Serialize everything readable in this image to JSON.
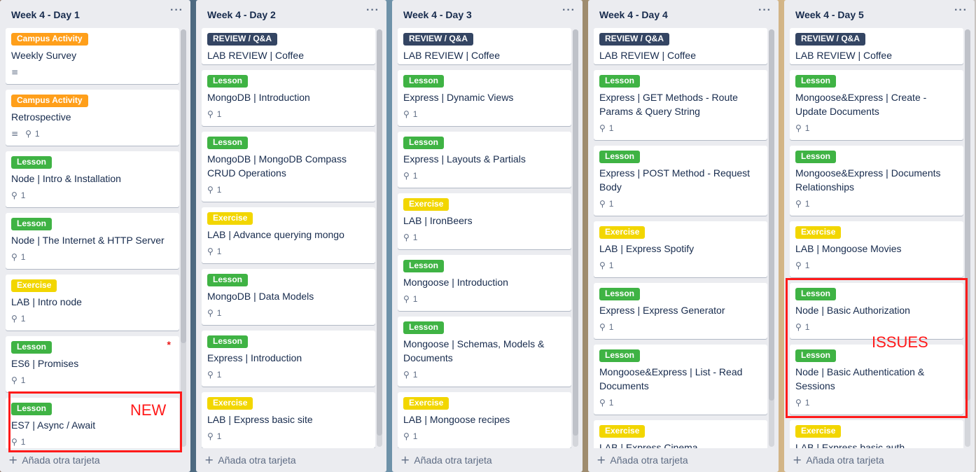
{
  "lists": [
    {
      "title": "Week 4 - Day 1",
      "add_card": "Añada otra tarjeta",
      "cards": [
        {
          "label": "Campus Activity",
          "label_color": "orange",
          "title": "Weekly Survey",
          "description": true,
          "attachments": ""
        },
        {
          "label": "Campus Activity",
          "label_color": "orange",
          "title": "Retrospective",
          "description": true,
          "attachments": "1"
        },
        {
          "label": "Lesson",
          "label_color": "green",
          "title": "Node | Intro & Installation",
          "description": false,
          "attachments": "1"
        },
        {
          "label": "Lesson",
          "label_color": "green",
          "title": "Node | The Internet & HTTP Server",
          "description": false,
          "attachments": "1"
        },
        {
          "label": "Exercise",
          "label_color": "yellow",
          "title": "LAB | Intro node",
          "description": false,
          "attachments": "1"
        },
        {
          "label": "Lesson",
          "label_color": "green",
          "title": "ES6 | Promises",
          "description": false,
          "attachments": "1",
          "star": "*"
        },
        {
          "label": "Lesson",
          "label_color": "green",
          "title": "ES7 | Async / Await",
          "description": false,
          "attachments": "1"
        }
      ]
    },
    {
      "title": "Week 4 - Day 2",
      "add_card": "Añada otra tarjeta",
      "cards": [
        {
          "label": "REVIEW / Q&A",
          "label_color": "dark",
          "title": "LAB REVIEW | Coffee",
          "description": false,
          "attachments": ""
        },
        {
          "label": "Lesson",
          "label_color": "green",
          "title": "MongoDB | Introduction",
          "description": false,
          "attachments": "1"
        },
        {
          "label": "Lesson",
          "label_color": "green",
          "title": "MongoDB | MongoDB Compass CRUD Operations",
          "description": false,
          "attachments": "1"
        },
        {
          "label": "Exercise",
          "label_color": "yellow",
          "title": "LAB | Advance querying mongo",
          "description": false,
          "attachments": "1"
        },
        {
          "label": "Lesson",
          "label_color": "green",
          "title": "MongoDB | Data Models",
          "description": false,
          "attachments": "1"
        },
        {
          "label": "Lesson",
          "label_color": "green",
          "title": "Express | Introduction",
          "description": false,
          "attachments": "1"
        },
        {
          "label": "Exercise",
          "label_color": "yellow",
          "title": "LAB | Express basic site",
          "description": false,
          "attachments": "1"
        }
      ]
    },
    {
      "title": "Week 4 - Day 3",
      "add_card": "Añada otra tarjeta",
      "cards": [
        {
          "label": "REVIEW / Q&A",
          "label_color": "dark",
          "title": "LAB REVIEW | Coffee",
          "description": false,
          "attachments": ""
        },
        {
          "label": "Lesson",
          "label_color": "green",
          "title": "Express | Dynamic Views",
          "description": false,
          "attachments": "1"
        },
        {
          "label": "Lesson",
          "label_color": "green",
          "title": "Express | Layouts & Partials",
          "description": false,
          "attachments": "1"
        },
        {
          "label": "Exercise",
          "label_color": "yellow",
          "title": "LAB | IronBeers",
          "description": false,
          "attachments": "1"
        },
        {
          "label": "Lesson",
          "label_color": "green",
          "title": "Mongoose | Introduction",
          "description": false,
          "attachments": "1"
        },
        {
          "label": "Lesson",
          "label_color": "green",
          "title": "Mongoose | Schemas, Models & Documents",
          "description": false,
          "attachments": "1"
        },
        {
          "label": "Exercise",
          "label_color": "yellow",
          "title": "LAB | Mongoose recipes",
          "description": false,
          "attachments": "1"
        }
      ]
    },
    {
      "title": "Week 4 - Day 4",
      "add_card": "Añada otra tarjeta",
      "cards": [
        {
          "label": "REVIEW / Q&A",
          "label_color": "dark",
          "title": "LAB REVIEW | Coffee",
          "description": false,
          "attachments": ""
        },
        {
          "label": "Lesson",
          "label_color": "green",
          "title": "Express | GET Methods - Route Params & Query String",
          "description": false,
          "attachments": "1"
        },
        {
          "label": "Lesson",
          "label_color": "green",
          "title": "Express | POST Method - Request Body",
          "description": false,
          "attachments": "1"
        },
        {
          "label": "Exercise",
          "label_color": "yellow",
          "title": "LAB | Express Spotify",
          "description": false,
          "attachments": "1"
        },
        {
          "label": "Lesson",
          "label_color": "green",
          "title": "Express | Express Generator",
          "description": false,
          "attachments": "1"
        },
        {
          "label": "Lesson",
          "label_color": "green",
          "title": "Mongoose&Express | List - Read Documents",
          "description": false,
          "attachments": "1"
        },
        {
          "label": "Exercise",
          "label_color": "yellow",
          "title": "LAB | Express Cinema",
          "description": false,
          "attachments": ""
        }
      ]
    },
    {
      "title": "Week 4 - Day 5",
      "add_card": "Añada otra tarjeta",
      "cards": [
        {
          "label": "REVIEW / Q&A",
          "label_color": "dark",
          "title": "LAB REVIEW | Coffee",
          "description": false,
          "attachments": ""
        },
        {
          "label": "Lesson",
          "label_color": "green",
          "title": "Mongoose&Express | Create - Update Documents",
          "description": false,
          "attachments": "1"
        },
        {
          "label": "Lesson",
          "label_color": "green",
          "title": "Mongoose&Express | Documents Relationships",
          "description": false,
          "attachments": "1"
        },
        {
          "label": "Exercise",
          "label_color": "yellow",
          "title": "LAB | Mongoose Movies",
          "description": false,
          "attachments": "1"
        },
        {
          "label": "Lesson",
          "label_color": "green",
          "title": "Node | Basic Authorization",
          "description": false,
          "attachments": "1"
        },
        {
          "label": "Lesson",
          "label_color": "green",
          "title": "Node | Basic Authentication & Sessions",
          "description": false,
          "attachments": "1"
        },
        {
          "label": "Exercise",
          "label_color": "yellow",
          "title": "LAB | Express basic auth",
          "description": false,
          "attachments": ""
        }
      ]
    }
  ],
  "annotations": {
    "new_text": "NEW",
    "issues_text": "ISSUES"
  },
  "colors": {
    "orange": "#ff9f1a",
    "green": "#3fb344",
    "yellow": "#f2d600",
    "dark": "#344563",
    "annotation": "#ff1a1a"
  }
}
